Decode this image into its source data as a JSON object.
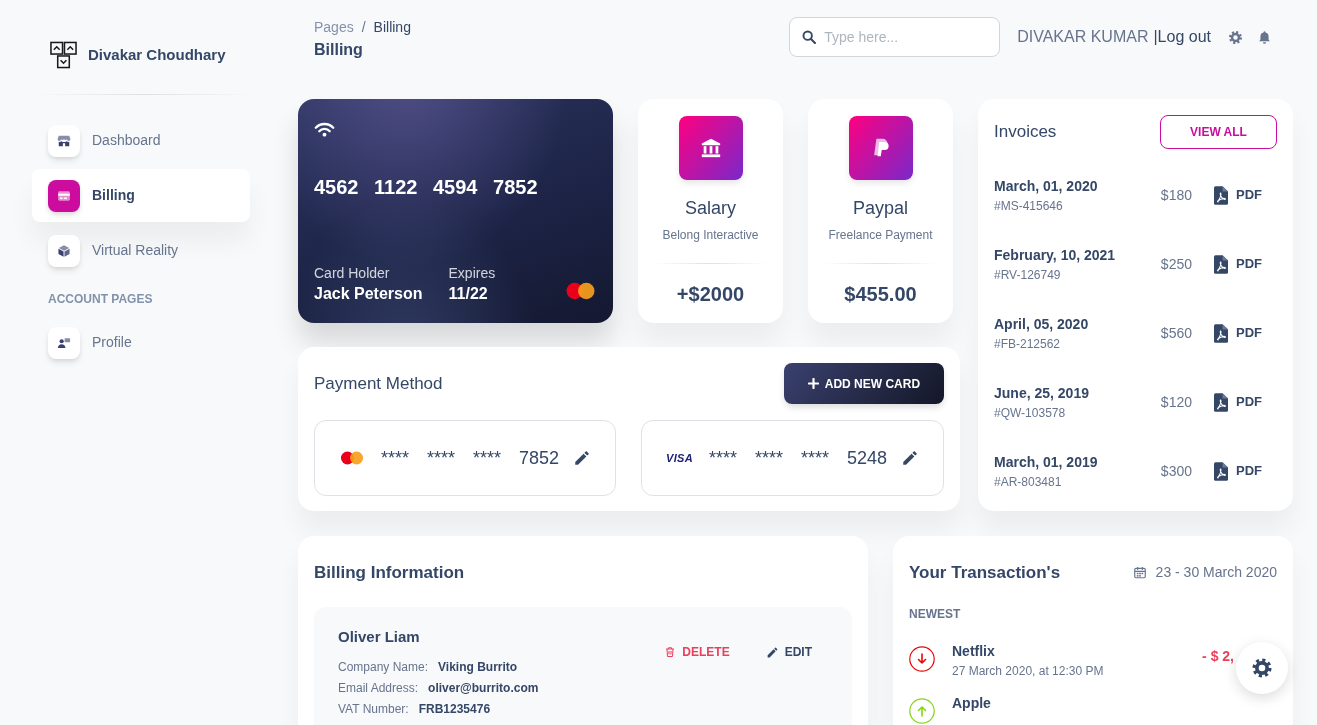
{
  "sidebar": {
    "brand": "Divakar Choudhary",
    "items": [
      {
        "kind": "shop",
        "label": "Dashboard",
        "selected": false
      },
      {
        "kind": "card",
        "label": "Billing",
        "selected": true
      },
      {
        "kind": "cube",
        "label": "Virtual Reality",
        "selected": false
      }
    ],
    "sections": [
      {
        "title": "ACCOUNT PAGES",
        "items": [
          {
            "kind": "profile",
            "label": "Profile",
            "selected": false
          }
        ]
      }
    ]
  },
  "header": {
    "breadcrumb": [
      "Pages",
      "Billing"
    ],
    "breadcrumb_separator": "/",
    "title": "Billing",
    "search": {
      "placeholder": "Type here..."
    },
    "user": "DIVAKAR KUMAR",
    "user_separator": "|",
    "logout": "Log out"
  },
  "credit_card": {
    "kind": "mastercard",
    "number": "4562 1122 4594 7852",
    "holder_label": "Card Holder",
    "holder": "Jack Peterson",
    "expires_label": "Expires",
    "expires": "11/22"
  },
  "income_cards": [
    {
      "kind": "bank",
      "title": "Salary",
      "subtitle": "Belong Interactive",
      "amount": "+$2000"
    },
    {
      "kind": "paypal",
      "title": "Paypal",
      "subtitle": "Freelance Payment",
      "amount": "$455.00"
    }
  ],
  "payment_method": {
    "title": "Payment Method",
    "button": "ADD NEW CARD",
    "cards": [
      {
        "kind": "mastercard",
        "number": "**** **** **** 7852"
      },
      {
        "kind": "visa",
        "logo": "VISA",
        "number": "**** **** **** 5248"
      }
    ]
  },
  "invoices": {
    "title": "Invoices",
    "button": "VIEW ALL",
    "items": [
      {
        "date": "March, 01, 2020",
        "number": "#MS-415646",
        "amount": "$180",
        "action": "PDF"
      },
      {
        "date": "February, 10, 2021",
        "number": "#RV-126749",
        "amount": "$250",
        "action": "PDF"
      },
      {
        "date": "April, 05, 2020",
        "number": "#FB-212562",
        "amount": "$560",
        "action": "PDF"
      },
      {
        "date": "June, 25, 2019",
        "number": "#QW-103578",
        "amount": "$120",
        "action": "PDF"
      },
      {
        "date": "March, 01, 2019",
        "number": "#AR-803481",
        "amount": "$300",
        "action": "PDF"
      }
    ]
  },
  "billing_information": {
    "title": "Billing Information",
    "entries": [
      {
        "name": "Oliver Liam",
        "delete": "DELETE",
        "edit": "EDIT",
        "fields": [
          {
            "label": "Company Name:",
            "value": "Viking Burrito"
          },
          {
            "label": "Email Address:",
            "value": "oliver@burrito.com"
          },
          {
            "label": "VAT Number:",
            "value": "FRB1235476"
          }
        ]
      }
    ]
  },
  "transactions": {
    "title": "Your Transaction's",
    "date_range": "23 - 30 March 2020",
    "groups": [
      {
        "title": "NEWEST",
        "items": [
          {
            "kind": "debit",
            "name": "Netflix",
            "date": "27 March 2020, at 12:30 PM",
            "amount": "- $ 2,"
          },
          {
            "kind": "credit",
            "name": "Apple"
          }
        ]
      }
    ]
  }
}
